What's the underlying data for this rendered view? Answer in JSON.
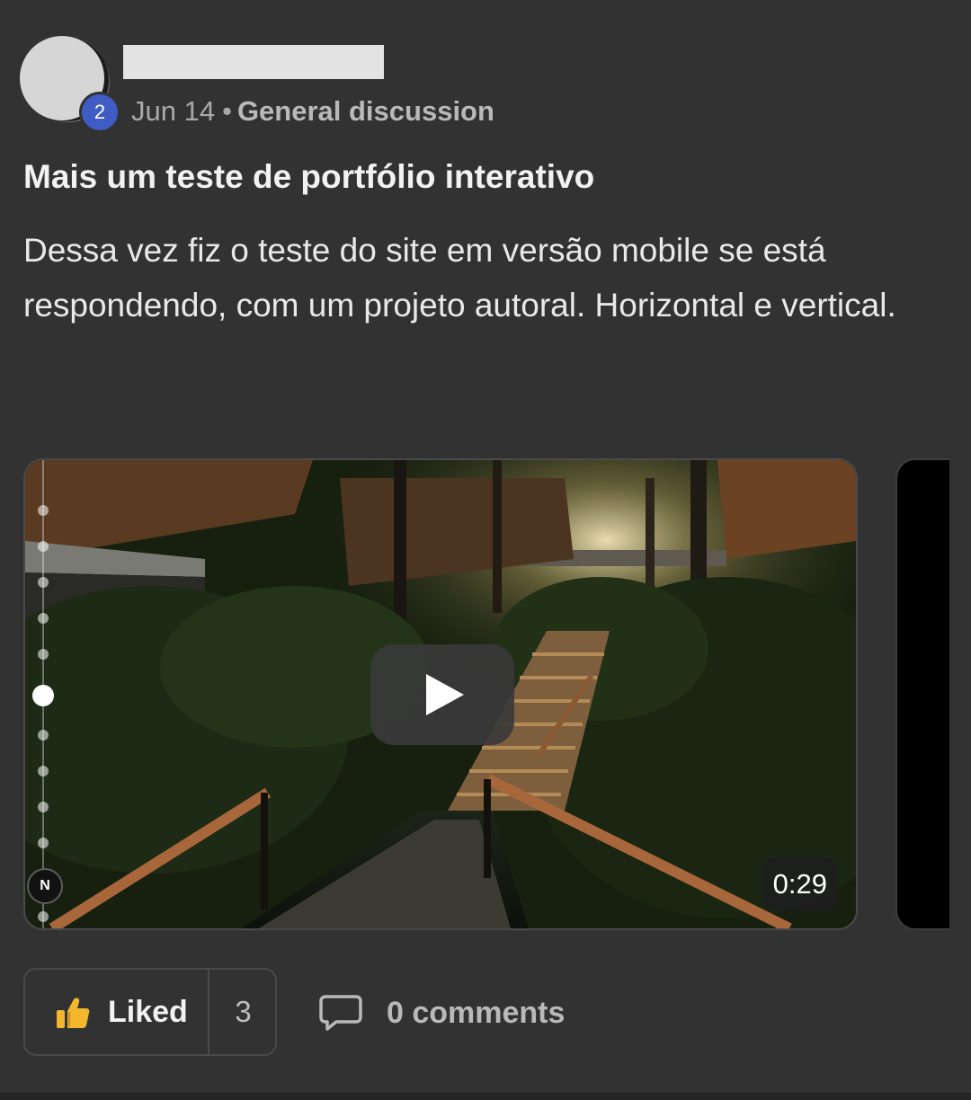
{
  "post": {
    "author": {
      "level": "2",
      "name_redacted": true
    },
    "date": "Jun 14",
    "separator": "•",
    "category": "General discussion",
    "title": "Mais um teste de portfólio interativo",
    "body": "Dessa vez fiz o teste do site em versão mobile se está respondendo, com um projeto autoral. Horizontal e vertical.",
    "media": {
      "duration": "0:29",
      "compass_label": "N",
      "play_icon": "play-icon"
    },
    "actions": {
      "like_label": "Liked",
      "like_count": "3",
      "comments_label": "0 comments",
      "like_icon": "thumbs-up-icon",
      "comment_icon": "comment-bubble-icon"
    }
  },
  "colors": {
    "background": "#323232",
    "level_badge": "#3f5bc4",
    "thumb": "#f2b62f"
  }
}
